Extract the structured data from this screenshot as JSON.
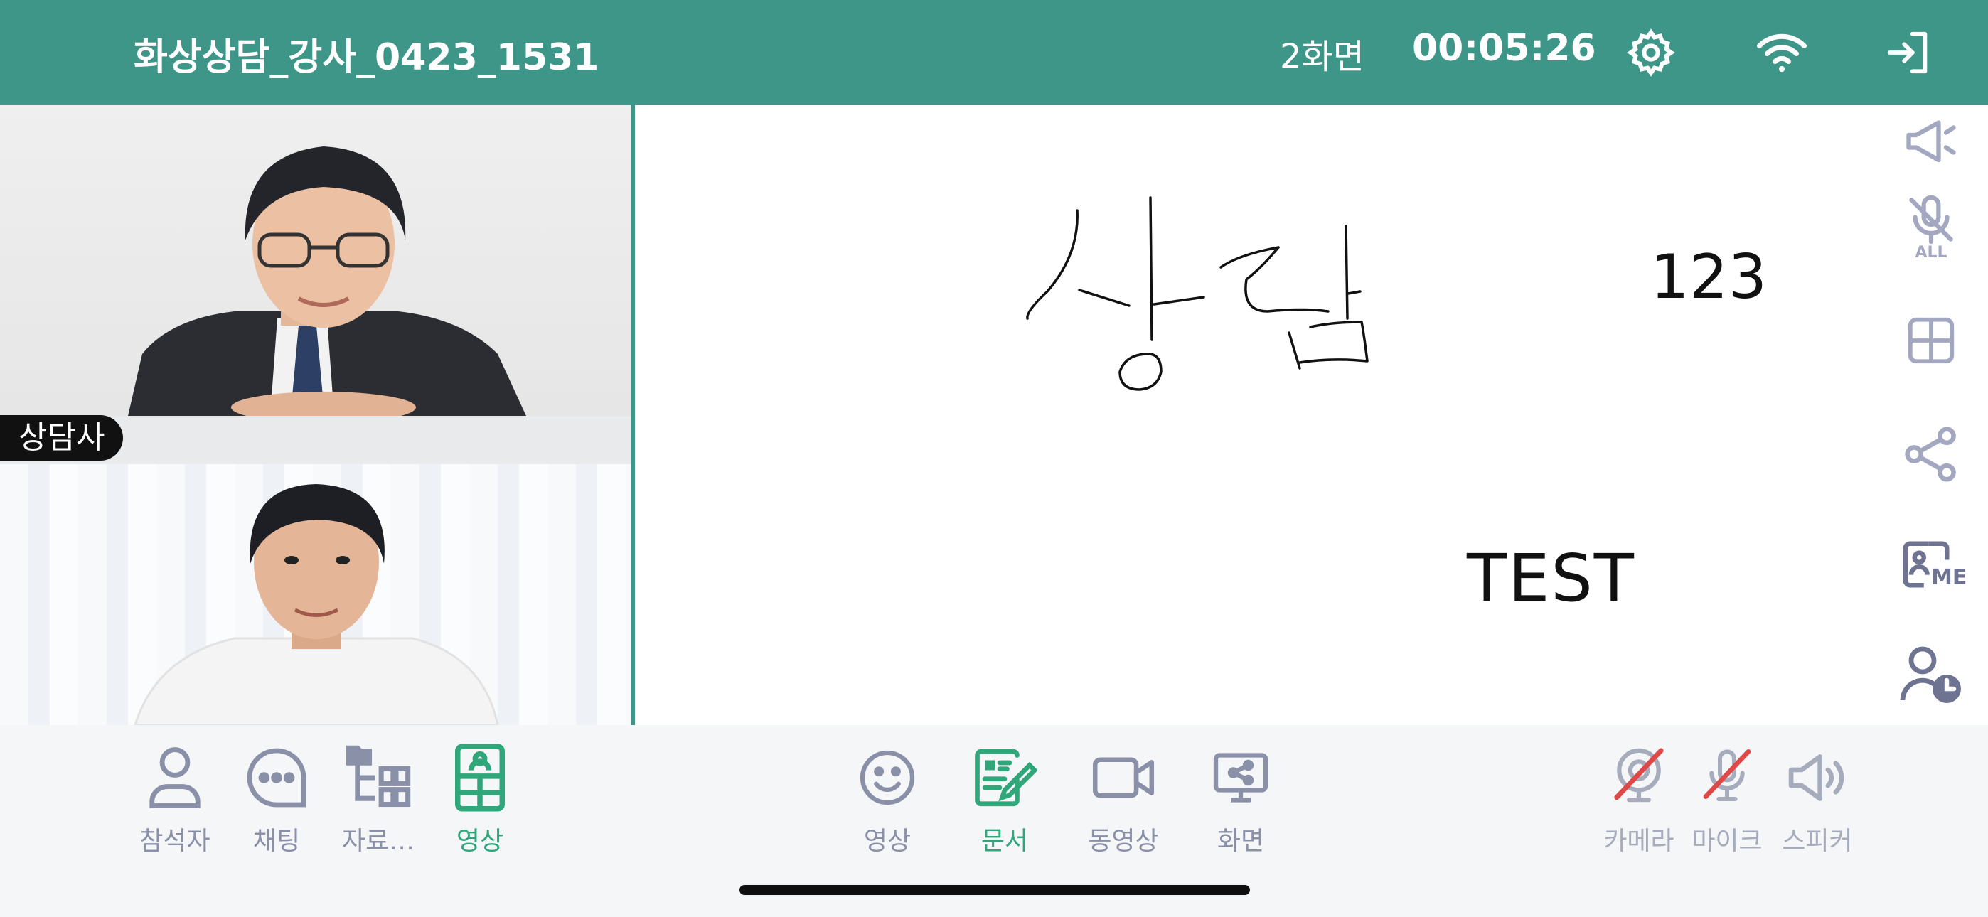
{
  "header": {
    "title": "화상상담_강사_0423_1531",
    "screen_count": "2화면",
    "timer": "00:05:26",
    "icons": [
      "settings-icon",
      "wifi-icon",
      "exit-icon"
    ]
  },
  "videos": {
    "counselor_label": "상담사"
  },
  "whiteboard": {
    "handwriting": "상담",
    "text_numbers": "123",
    "text_test": "TEST"
  },
  "right_toolbar": {
    "items": [
      "megaphone-icon",
      "mute-all-icon",
      "layout-grid-icon",
      "share-icon",
      "me-view-icon",
      "user-time-icon"
    ],
    "mute_all_label": "ALL",
    "me_label": "ME"
  },
  "bottom_left": [
    {
      "label": "참석자",
      "icon": "participant-icon"
    },
    {
      "label": "채팅",
      "icon": "chat-icon"
    },
    {
      "label": "자료…",
      "icon": "folder-tree-icon"
    },
    {
      "label": "영상",
      "icon": "video-layout-icon",
      "active": true
    }
  ],
  "bottom_center": [
    {
      "label": "영상",
      "icon": "smile-icon"
    },
    {
      "label": "문서",
      "icon": "document-edit-icon",
      "active": true
    },
    {
      "label": "동영상",
      "icon": "video-camera-icon"
    },
    {
      "label": "화면",
      "icon": "screen-share-icon"
    }
  ],
  "bottom_right": [
    {
      "label": "카메라",
      "icon": "camera-off-icon"
    },
    {
      "label": "마이크",
      "icon": "mic-off-icon"
    },
    {
      "label": "스피커",
      "icon": "speaker-icon"
    }
  ],
  "colors": {
    "header_bg": "#3d9688",
    "accent_active": "#2fa77a",
    "icon_gray": "#8a90a8",
    "off_red": "#e04848"
  }
}
